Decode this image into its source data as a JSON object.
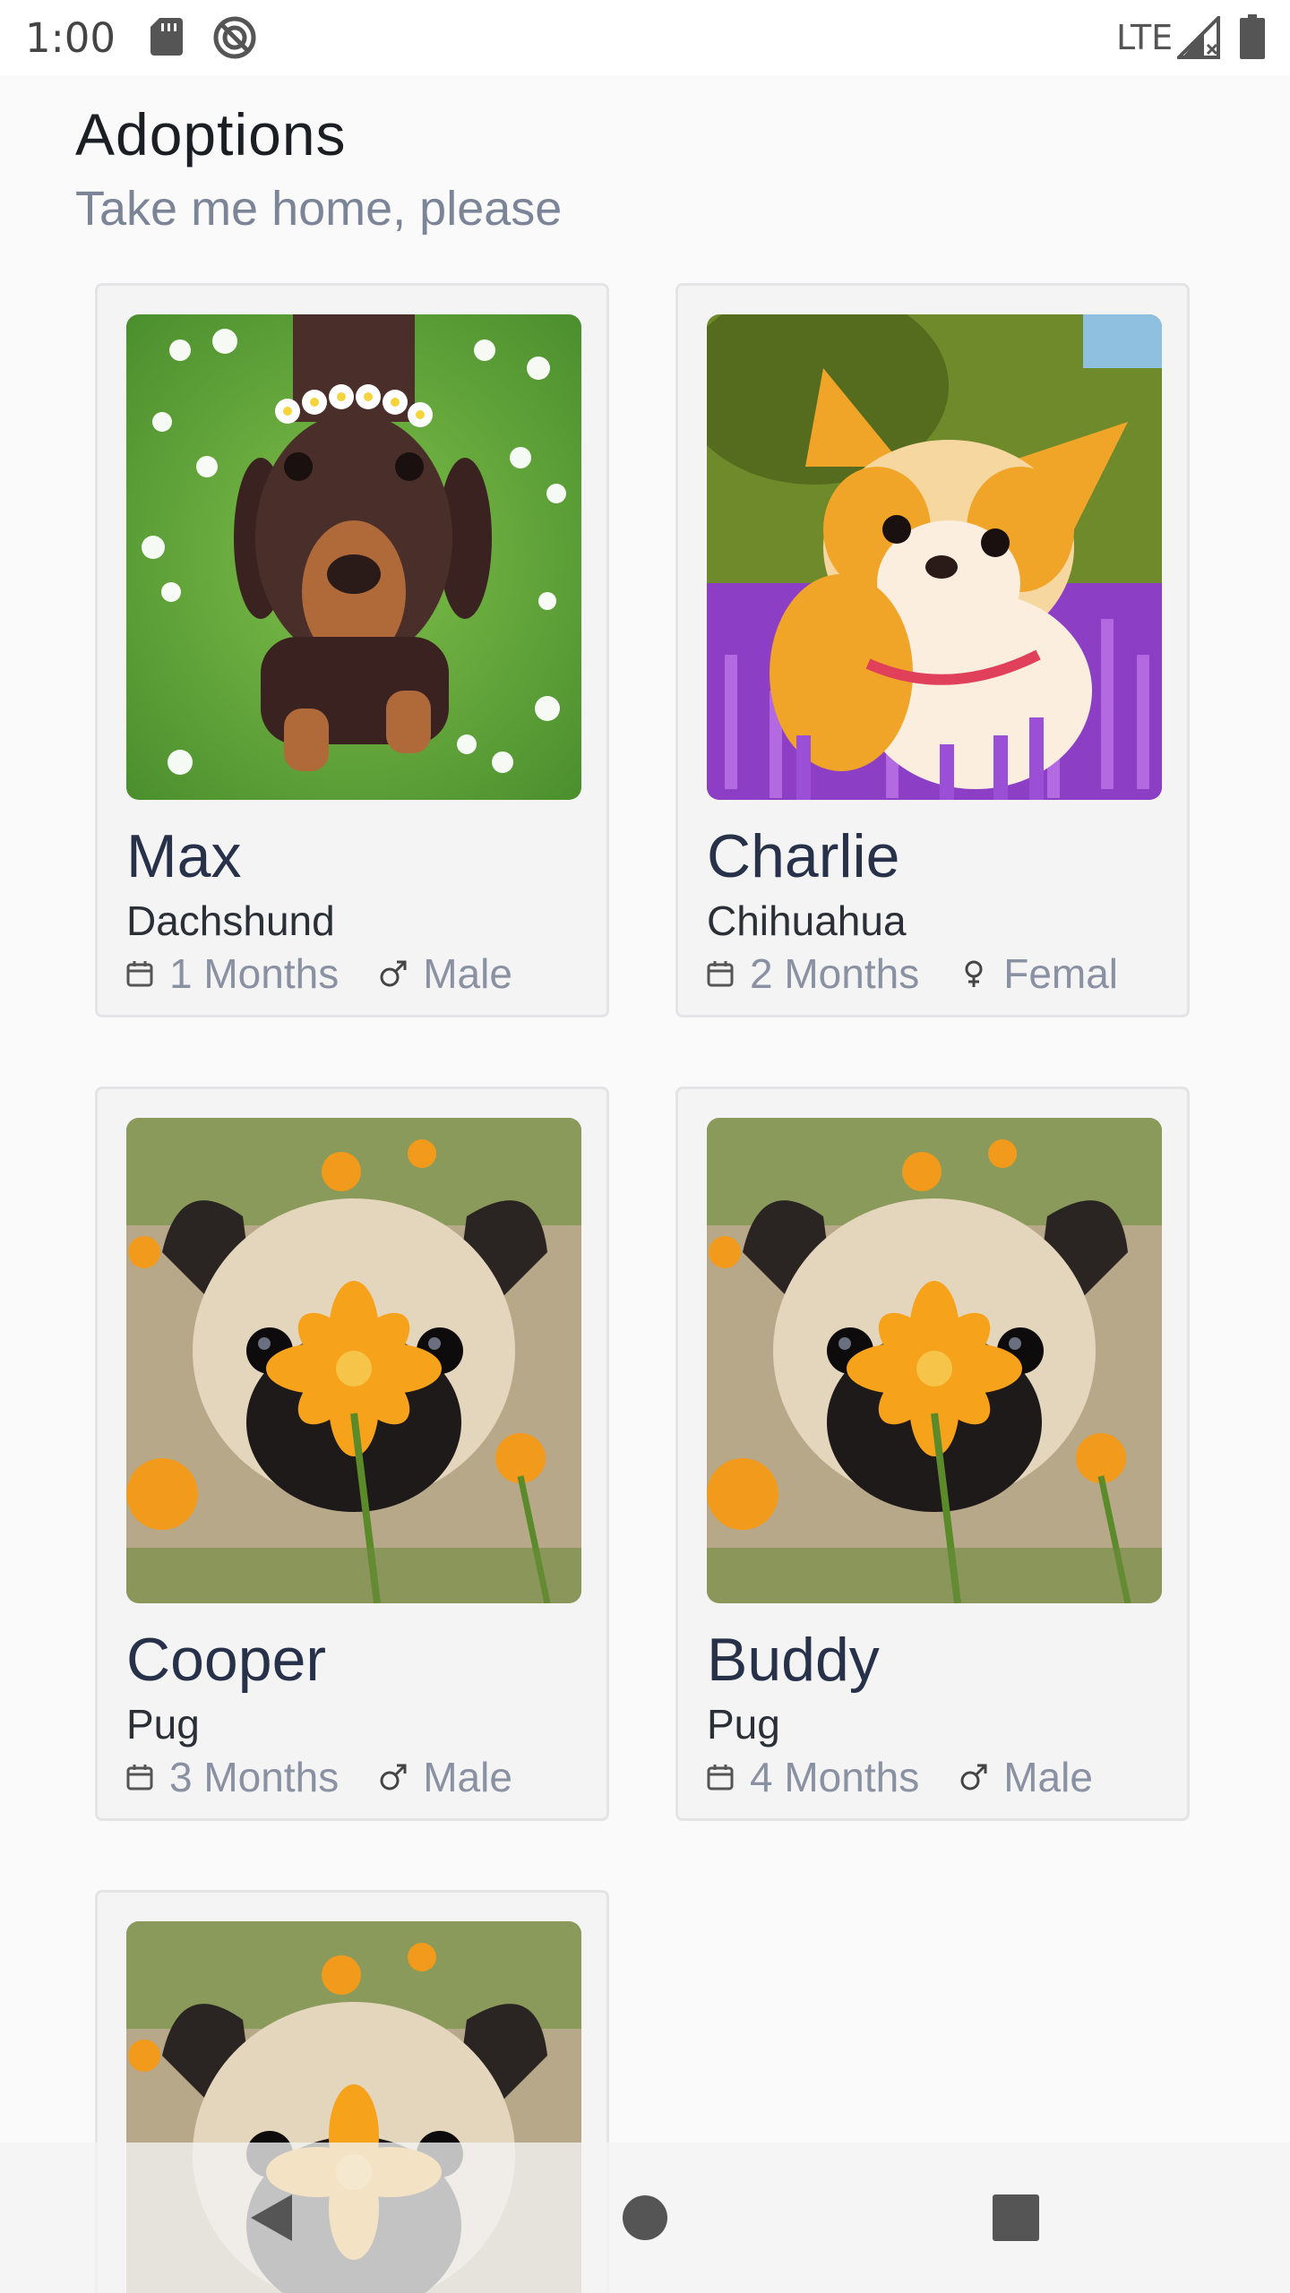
{
  "status_bar": {
    "time": "1:00",
    "network": "LTE",
    "icons": [
      "sd-card-icon",
      "sync-icon",
      "signal-icon",
      "battery-icon"
    ]
  },
  "header": {
    "title": "Adoptions",
    "subtitle": "Take me home, please"
  },
  "pets": [
    {
      "name": "Max",
      "breed": "Dachshund",
      "age": "1 Months",
      "gender": "Male",
      "gender_icon": "male-icon",
      "photo": "dachshund-photo"
    },
    {
      "name": "Charlie",
      "breed": "Chihuahua",
      "age": "2 Months",
      "gender": "Femal",
      "gender_icon": "female-icon",
      "photo": "chihuahua-photo"
    },
    {
      "name": "Cooper",
      "breed": "Pug",
      "age": "3 Months",
      "gender": "Male",
      "gender_icon": "male-icon",
      "photo": "pug-photo"
    },
    {
      "name": "Buddy",
      "breed": "Pug",
      "age": "4 Months",
      "gender": "Male",
      "gender_icon": "male-icon",
      "photo": "pug-photo"
    },
    {
      "name": "",
      "breed": "",
      "age": "",
      "gender": "",
      "gender_icon": "",
      "photo": "pug-photo"
    }
  ],
  "nav_bar": {
    "icons": [
      "back-icon",
      "home-icon",
      "recents-icon"
    ]
  },
  "colors": {
    "background": "#fafafa",
    "card": "#f4f4f5",
    "name": "#27324a",
    "subtitle": "#7c8598"
  }
}
